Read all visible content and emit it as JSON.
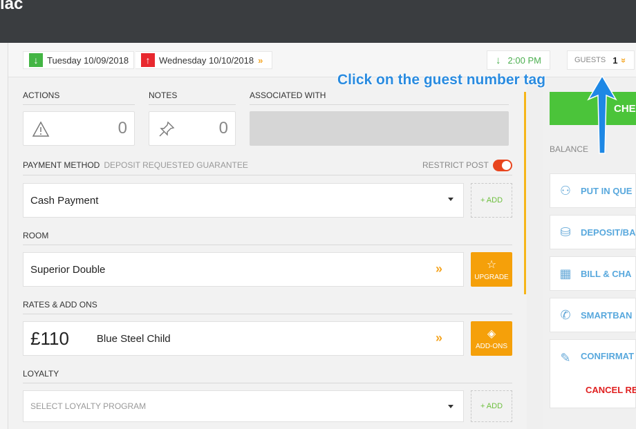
{
  "topbar": {
    "title": "iac"
  },
  "header": {
    "arrival_date": "Tuesday 10/09/2018",
    "departure_date": "Wednesday 10/10/2018",
    "time": "2:00 PM",
    "guests_label": "GUESTS",
    "guests_count": "1"
  },
  "annotation": {
    "text": "Click on the guest number tag"
  },
  "counters": {
    "actions_label": "ACTIONS",
    "actions_count": "0",
    "notes_label": "NOTES",
    "notes_count": "0",
    "associated_label": "ASSOCIATED WITH"
  },
  "payment": {
    "label": "PAYMENT METHOD",
    "sub": "DEPOSIT REQUESTED GUARANTEE",
    "restrict_label": "RESTRICT POST",
    "restrict_on": true,
    "value": "Cash Payment",
    "add_label": "+ ADD"
  },
  "room": {
    "label": "ROOM",
    "value": "Superior Double",
    "upgrade_label": "UPGRADE"
  },
  "rates": {
    "label": "RATES & ADD ONS",
    "price": "£110",
    "rate_name": "Blue Steel Child",
    "addons_label": "ADD-ONS"
  },
  "loyalty": {
    "label": "LOYALTY",
    "placeholder": "SELECT LOYALTY PROGRAM",
    "add_label": "+ ADD"
  },
  "sidebar": {
    "checkin_label": "CHE",
    "balance_label": "BALANCE",
    "buttons": [
      {
        "label": "PUT IN QUE",
        "icon": "people-icon"
      },
      {
        "label": "DEPOSIT/BA",
        "icon": "coins-icon"
      },
      {
        "label": "BILL & CHA",
        "icon": "calculator-icon"
      },
      {
        "label": "SMARTBAN",
        "icon": "phone-icon"
      },
      {
        "label": "CONFIRMAT",
        "icon": "pen-icon"
      }
    ],
    "cancel_label": "CANCEL RE"
  },
  "colors": {
    "accent_green": "#4bc43a",
    "accent_orange": "#f5a00a",
    "link_blue": "#58a8dd",
    "danger_red": "#e02020",
    "annotation_blue": "#2a8bdf"
  }
}
